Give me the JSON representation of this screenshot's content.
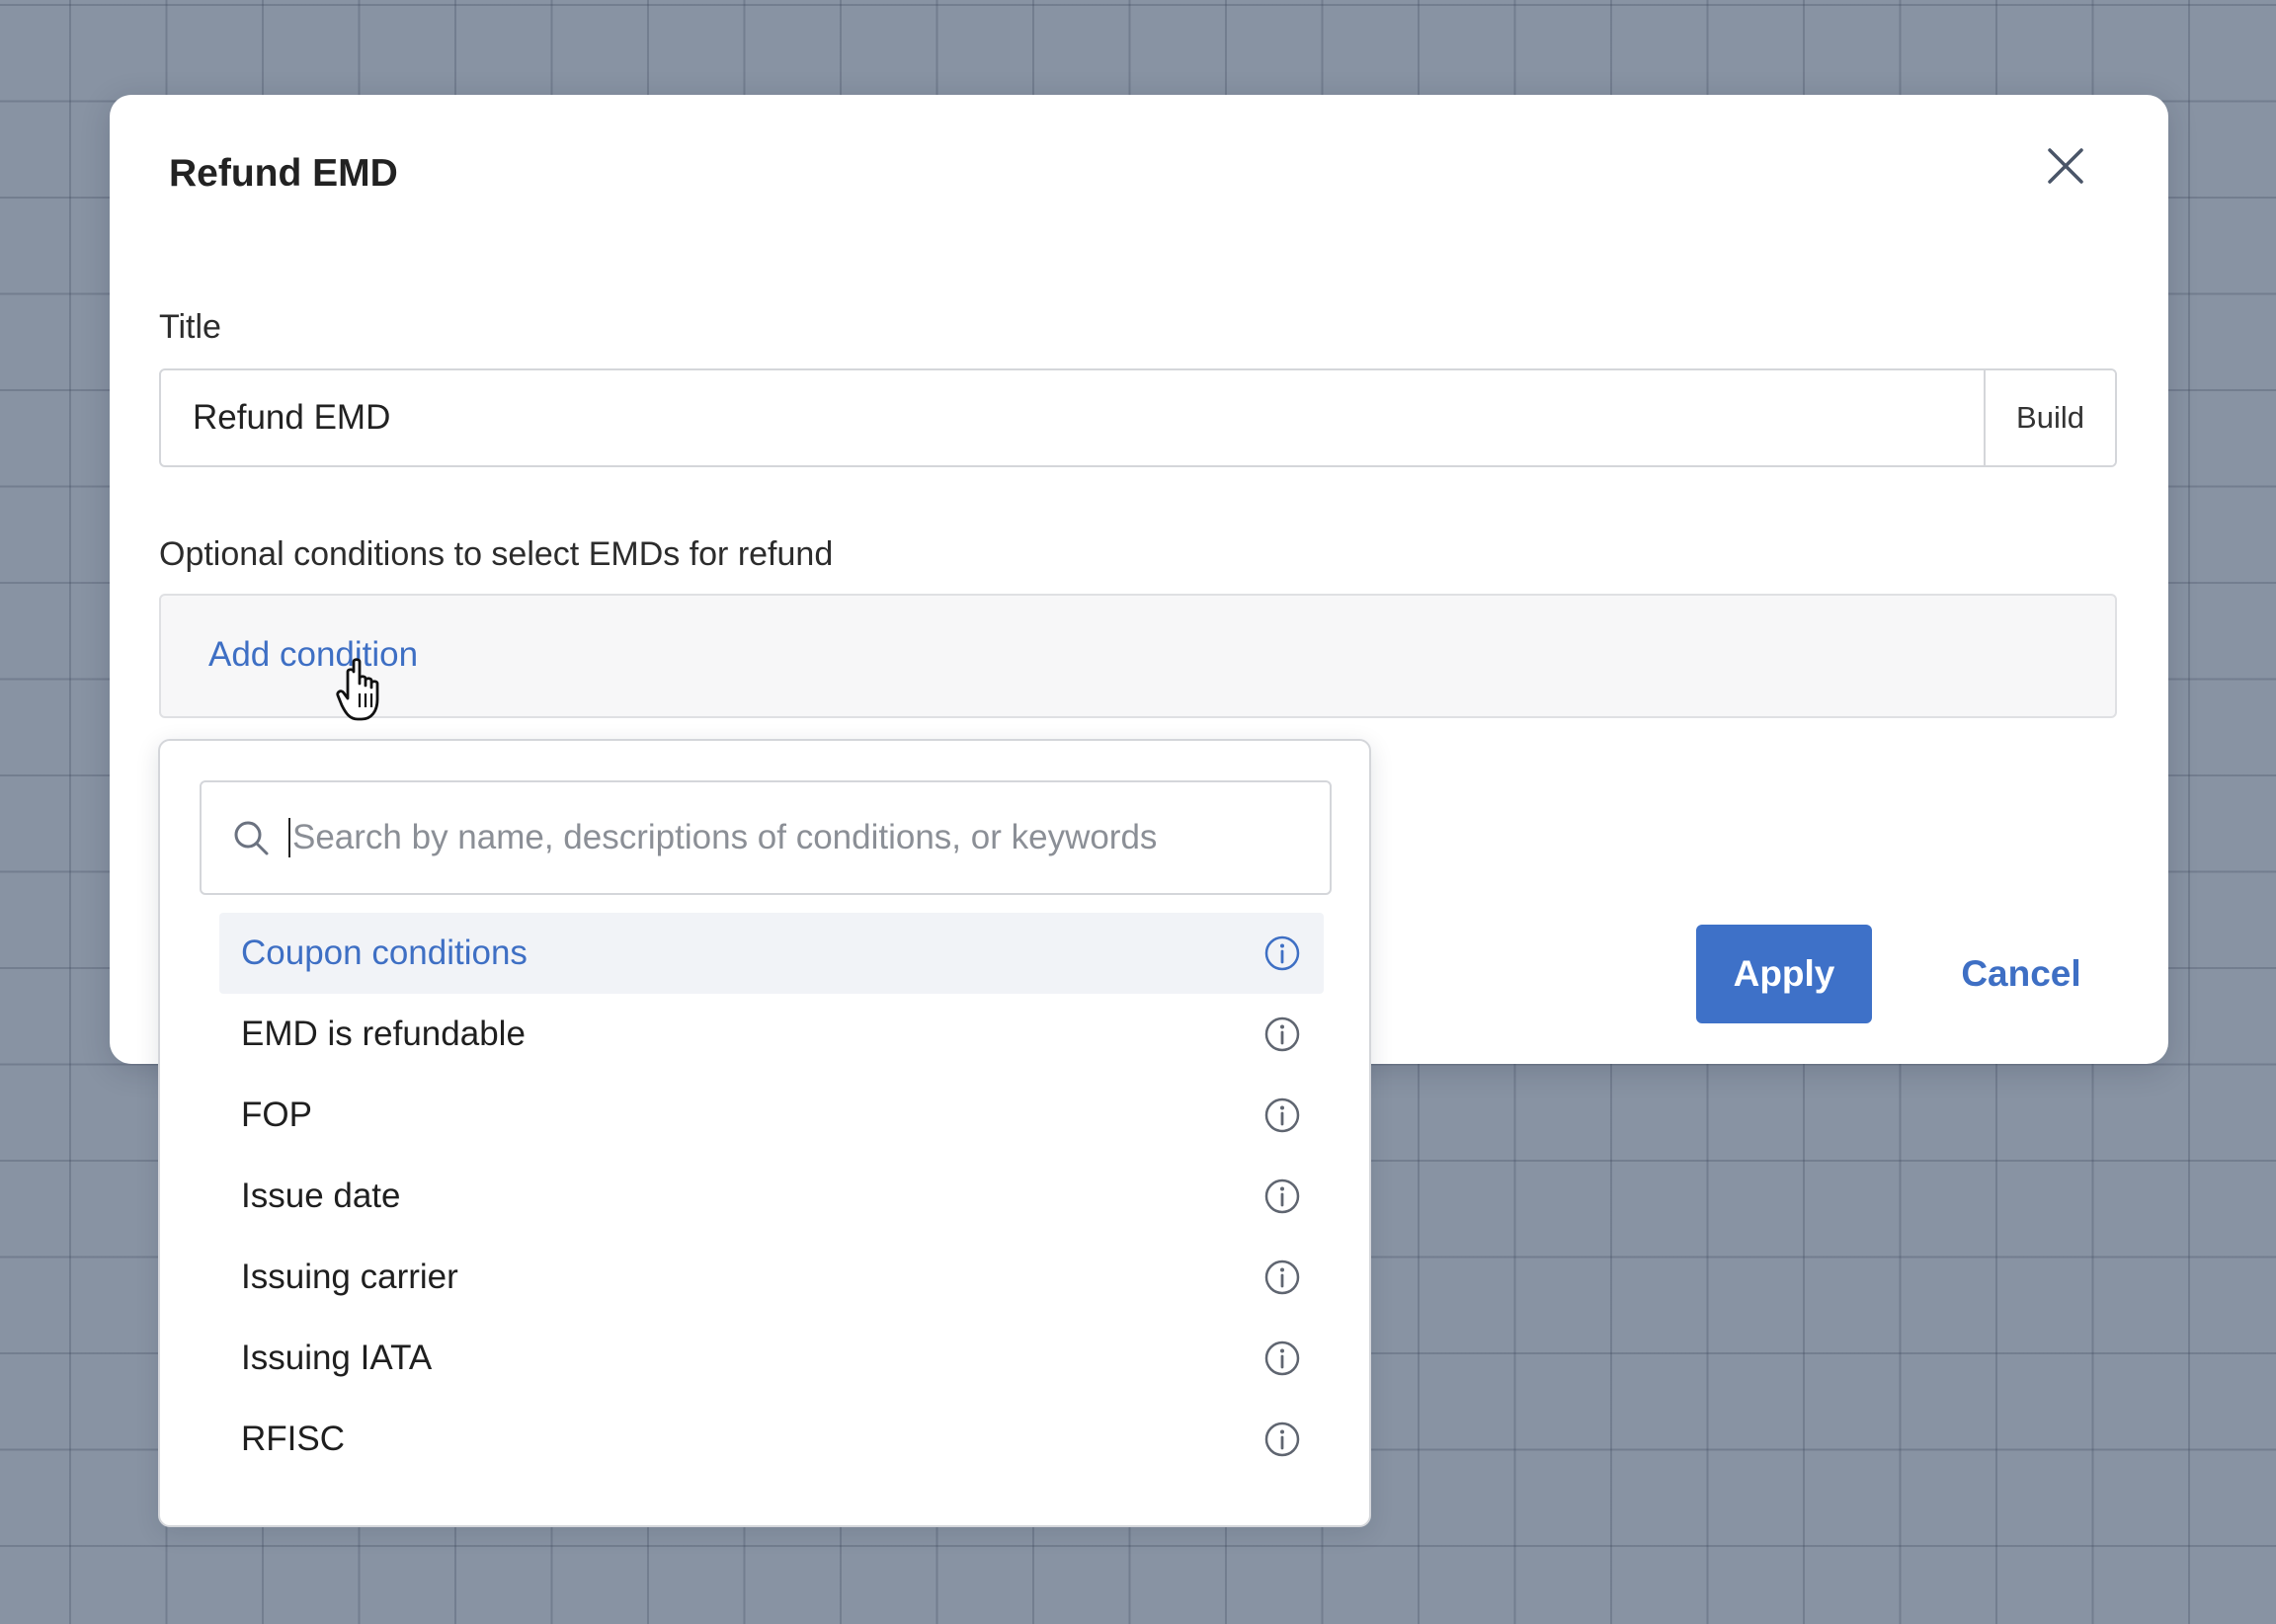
{
  "modal": {
    "title": "Refund EMD",
    "title_field": {
      "label": "Title",
      "value": "Refund EMD",
      "build_label": "Build"
    },
    "conditions": {
      "label": "Optional conditions to select EMDs for refund",
      "add_label": "Add condition"
    },
    "apply_label": "Apply",
    "cancel_label": "Cancel"
  },
  "dropdown": {
    "search_placeholder": "Search by name, descriptions of conditions, or keywords",
    "options": [
      {
        "label": "Coupon conditions",
        "highlighted": true
      },
      {
        "label": "EMD is refundable"
      },
      {
        "label": "FOP"
      },
      {
        "label": "Issue date"
      },
      {
        "label": "Issuing carrier"
      },
      {
        "label": "Issuing IATA"
      },
      {
        "label": "RFISC"
      }
    ]
  },
  "colors": {
    "accent": "#3e71c8",
    "link": "#3e6fc4",
    "backdrop": "#8893a3",
    "highlight": "#f1f3f7"
  },
  "icons": {
    "close": "close-icon",
    "search": "search-icon",
    "info": "info-icon",
    "cursor": "hand-cursor-icon"
  }
}
